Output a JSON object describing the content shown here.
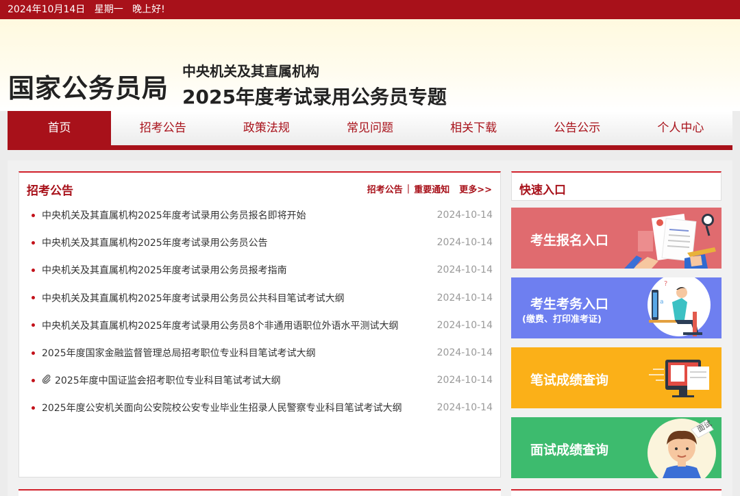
{
  "topbar": {
    "date": "2024年10月14日",
    "weekday": "星期一",
    "greeting": "晚上好!"
  },
  "header": {
    "logo": "国家公务员局",
    "subtitle1": "中央机关及其直属机构",
    "subtitle2": "2025年度考试录用公务员专题"
  },
  "nav": [
    "首页",
    "招考公告",
    "政策法规",
    "常见问题",
    "相关下载",
    "公告公示",
    "个人中心"
  ],
  "panel": {
    "title": "招考公告",
    "link1": "招考公告",
    "sep": "|",
    "link2": "重要通知",
    "more": "更多>>",
    "items": [
      {
        "title": "中央机关及其直属机构2025年度考试录用公务员报名即将开始",
        "date": "2024-10-14"
      },
      {
        "title": "中央机关及其直属机构2025年度考试录用公务员公告",
        "date": "2024-10-14"
      },
      {
        "title": "中央机关及其直属机构2025年度考试录用公务员报考指南",
        "date": "2024-10-14"
      },
      {
        "title": "中央机关及其直属机构2025年度考试录用公务员公共科目笔试考试大纲",
        "date": "2024-10-14"
      },
      {
        "title": "中央机关及其直属机构2025年度考试录用公务员8个非通用语职位外语水平测试大纲",
        "date": "2024-10-14"
      },
      {
        "title": "2025年度国家金融监督管理总局招考职位专业科目笔试考试大纲",
        "date": "2024-10-14"
      },
      {
        "title": "2025年度中国证监会招考职位专业科目笔试考试大纲",
        "date": "2024-10-14"
      },
      {
        "title": "2025年度公安机关面向公安院校公安专业毕业生招录人民警察专业科目笔试考试大纲",
        "date": "2024-10-14"
      }
    ]
  },
  "side": {
    "title": "快速入口",
    "cards": {
      "register": "考生报名入口",
      "affairs": "考生考务入口",
      "affairs_sub": "(缴费、打印准考证)",
      "written": "笔试成绩查询",
      "interview": "面试成绩查询",
      "interview_badge": "面试"
    }
  },
  "colors": {
    "brand_red": "#a8111a",
    "card_register": "#e06b6f",
    "card_affairs": "#6e7ff0",
    "card_written": "#fbb018",
    "card_interview": "#3dbb6e"
  },
  "icons": {
    "attachment": "paperclip-icon"
  }
}
